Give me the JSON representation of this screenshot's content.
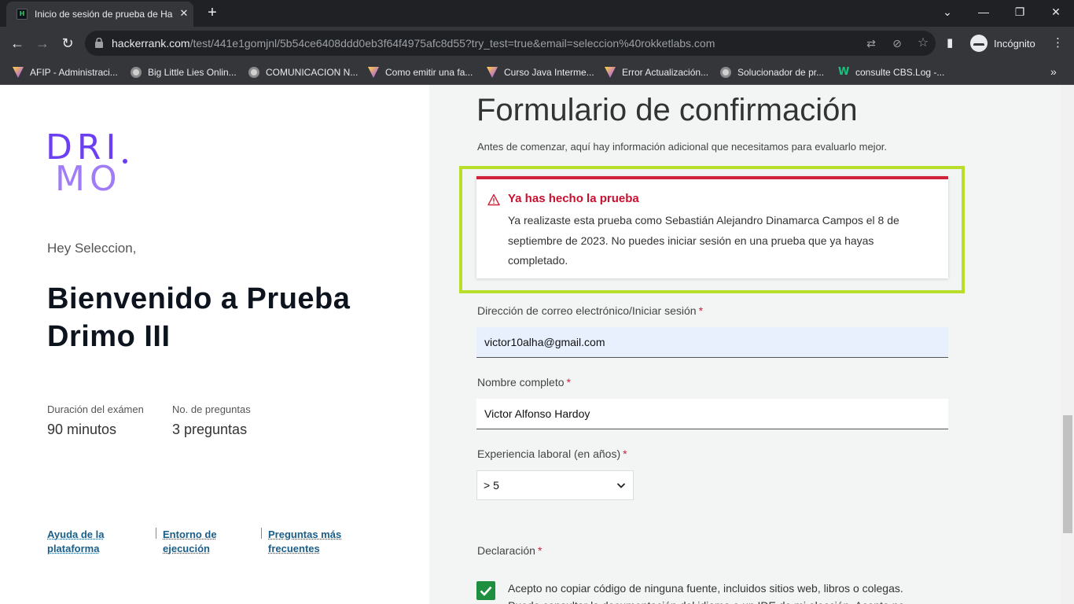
{
  "browser": {
    "tab_title": "Inicio de sesión de prueba de Ha",
    "tab_close": "✕",
    "new_tab": "+",
    "url_host": "hackerrank.com",
    "url_path": "/test/441e1gomjnl/5b54ce6408ddd0eb3f64f4975afc8d55?try_test=true&email=seleccion%40rokketlabs.com",
    "incognito_label": "Incógnito",
    "bookmarks": [
      {
        "label": "AFIP - Administraci...",
        "icon": "v"
      },
      {
        "label": "Big Little Lies Onlin...",
        "icon": "g"
      },
      {
        "label": "COMUNICACION N...",
        "icon": "g"
      },
      {
        "label": "Como emitir una fa...",
        "icon": "v"
      },
      {
        "label": "Curso Java Interme...",
        "icon": "v"
      },
      {
        "label": "Error Actualización...",
        "icon": "v"
      },
      {
        "label": "Solucionador de pr...",
        "icon": "g"
      },
      {
        "label": "consulte CBS.Log -...",
        "icon": "w"
      }
    ]
  },
  "left": {
    "logo_row1": "DRI",
    "logo_row2": "MO",
    "greeting": "Hey Seleccion,",
    "welcome": "Bienvenido a Prueba Drimo III",
    "stats": [
      {
        "label": "Duración del exámen",
        "value": "90 minutos"
      },
      {
        "label": "No. de preguntas",
        "value": "3 preguntas"
      }
    ],
    "footer_links": [
      {
        "line1": "Ayuda de la",
        "line2": "plataforma"
      },
      {
        "line1": "Entorno de",
        "line2": "ejecución"
      },
      {
        "line1": "Preguntas más",
        "line2": "frecuentes"
      }
    ]
  },
  "form": {
    "title": "Formulario de confirmación",
    "subtitle": "Antes de comenzar, aquí hay información adicional que necesitamos para evaluarlo mejor.",
    "alert": {
      "title": "Ya has hecho la prueba",
      "body": "Ya realizaste esta prueba como Sebastián Alejandro Dinamarca Campos el 8 de septiembre de 2023. No puedes iniciar sesión en una prueba que ya hayas completado."
    },
    "email": {
      "label": "Dirección de correo electrónico/Iniciar sesión",
      "value": "victor10alha@gmail.com"
    },
    "name": {
      "label": "Nombre completo",
      "value": "Victor Alfonso Hardoy"
    },
    "experience": {
      "label": "Experiencia laboral (en años)",
      "value": "> 5"
    },
    "declaration": {
      "label": "Declaración",
      "checked": true,
      "text": "Acepto no copiar código de ninguna fuente, incluidos sitios web, libros o colegas. Puedo consultar la documentación del idioma o un IDE de mi elección. Acepto no"
    },
    "required_mark": "*"
  },
  "colors": {
    "brand_purple": "#6b3ff2",
    "alert_red": "#d0223a",
    "highlight": "#b8dd2a",
    "checkbox_green": "#1e8f3e"
  }
}
